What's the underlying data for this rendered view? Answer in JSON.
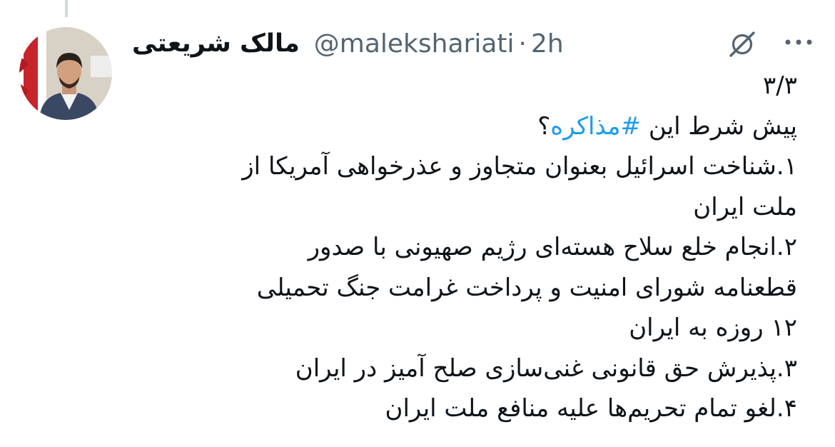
{
  "tweet": {
    "author": {
      "display_name": "مالک شریعتی",
      "handle": "@malekshariati",
      "separator": "·",
      "time": "2h"
    },
    "icons": {
      "grok": "grok-slash-icon",
      "more": "more-horizontal-icon"
    },
    "colors": {
      "hashtag": "#1d9bf0",
      "secondary_text": "#536471",
      "text": "#0f1419",
      "thread_line": "#cfd9de"
    },
    "body": {
      "counter": "۳/۳",
      "intro_before": "پیش شرط این ",
      "hashtag": "#مذاکره",
      "intro_after": "؟",
      "lines": [
        "۱.شناخت اسرائیل بعنوان متجاوز و عذرخواهی آمریکا از",
        "ملت ایران",
        "۲.انجام خلع سلاح هسته‌ای رژیم صهیونی با صدور",
        "قطعنامه شورای امنیت و پرداخت غرامت جنگ تحمیلی",
        "۱۲ روزه به ایران",
        "۳.پذیرش حق قانونی غنی‌سازی صلح آمیز در ایران",
        "۴.لغو تمام تحریم‌ها علیه منافع ملت ایران"
      ]
    }
  }
}
